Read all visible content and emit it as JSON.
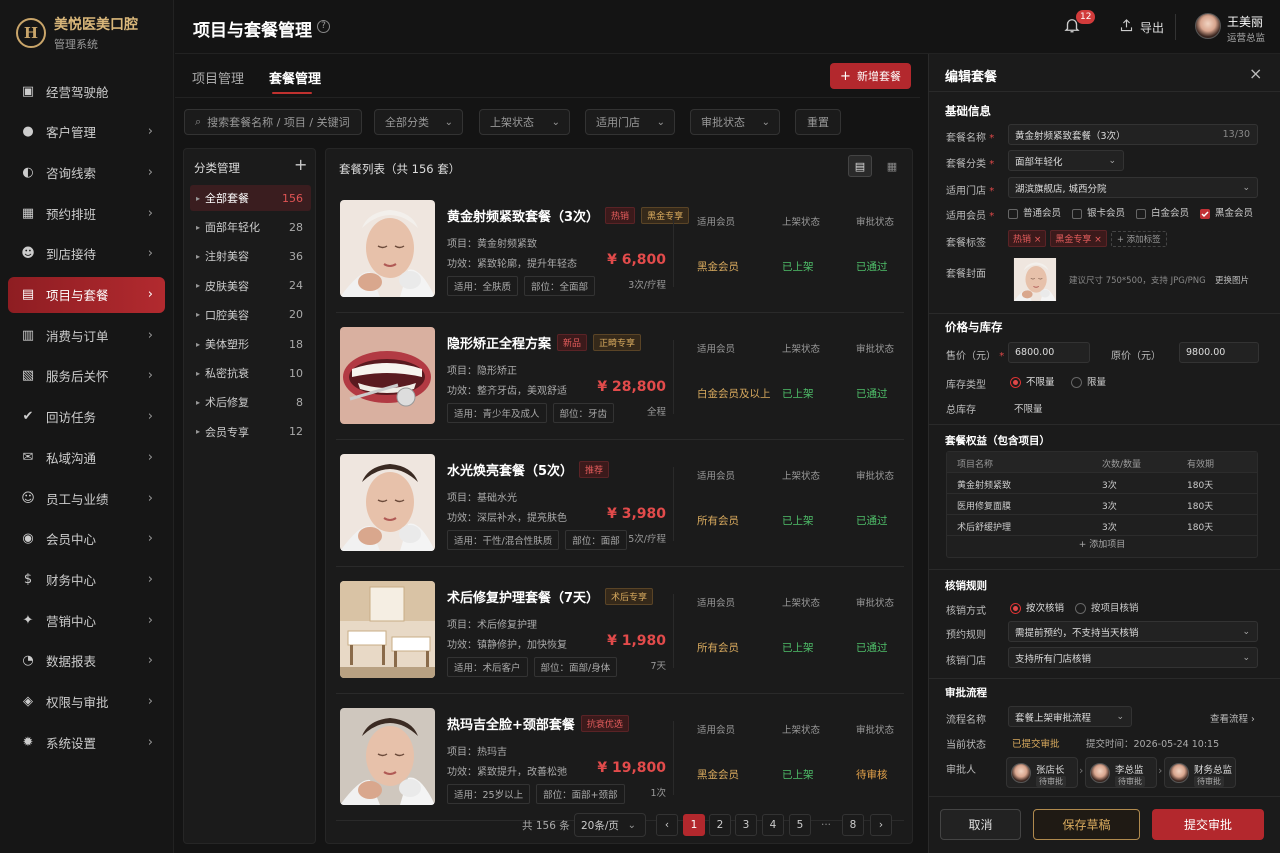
{
  "brand": {
    "logo": "H",
    "name": "美悦医美口腔",
    "sub": "管理系统"
  },
  "nav": [
    {
      "label": "经营驾驶舱",
      "icon": "dashboard-icon",
      "glyph": "▣",
      "chev": false
    },
    {
      "label": "客户管理",
      "icon": "user-icon",
      "glyph": "●",
      "chev": true
    },
    {
      "label": "咨询线索",
      "icon": "consult-icon",
      "glyph": "◐",
      "chev": true
    },
    {
      "label": "预约排班",
      "icon": "calendar-icon",
      "glyph": "▦",
      "chev": true
    },
    {
      "label": "到店接待",
      "icon": "reception-icon",
      "glyph": "☻",
      "chev": true
    },
    {
      "label": "项目与套餐",
      "icon": "package-icon",
      "glyph": "▤",
      "chev": true
    },
    {
      "label": "消费与订单",
      "icon": "order-icon",
      "glyph": "▥",
      "chev": true
    },
    {
      "label": "服务后关怀",
      "icon": "care-icon",
      "glyph": "▧",
      "chev": true
    },
    {
      "label": "回访任务",
      "icon": "task-icon",
      "glyph": "✔",
      "chev": true
    },
    {
      "label": "私域沟通",
      "icon": "chat-icon",
      "glyph": "✉",
      "chev": true
    },
    {
      "label": "员工与业绩",
      "icon": "staff-icon",
      "glyph": "☺",
      "chev": true
    },
    {
      "label": "会员中心",
      "icon": "member-icon",
      "glyph": "◉",
      "chev": true
    },
    {
      "label": "财务中心",
      "icon": "finance-icon",
      "glyph": "$",
      "chev": true
    },
    {
      "label": "营销中心",
      "icon": "marketing-icon",
      "glyph": "✦",
      "chev": true
    },
    {
      "label": "数据报表",
      "icon": "report-icon",
      "glyph": "◔",
      "chev": true
    },
    {
      "label": "权限与审批",
      "icon": "shield-icon",
      "glyph": "◈",
      "chev": true
    },
    {
      "label": "系统设置",
      "icon": "gear-icon",
      "glyph": "✹",
      "chev": true
    }
  ],
  "header": {
    "title": "项目与套餐管理",
    "notif_count": "12",
    "export": "导出",
    "user_name": "王美丽",
    "user_role": "运营总监"
  },
  "tabs": [
    "项目管理",
    "套餐管理"
  ],
  "new_button": "新增套餐",
  "filters": {
    "search_placeholder": "搜索套餐名称 / 项目 / 关键词",
    "category": "全部分类",
    "shelf": "上架状态",
    "store": "适用门店",
    "approval": "审批状态",
    "reset": "重置"
  },
  "categories": {
    "title": "分类管理",
    "items": [
      {
        "name": "全部套餐",
        "count": "156"
      },
      {
        "name": "面部年轻化",
        "count": "28"
      },
      {
        "name": "注射美容",
        "count": "36"
      },
      {
        "name": "皮肤美容",
        "count": "24"
      },
      {
        "name": "口腔美容",
        "count": "20"
      },
      {
        "name": "美体塑形",
        "count": "18"
      },
      {
        "name": "私密抗衰",
        "count": "10"
      },
      {
        "name": "术后修复",
        "count": "8"
      },
      {
        "name": "会员专享",
        "count": "12"
      }
    ]
  },
  "list": {
    "title": "套餐列表（共 156 套）",
    "col_member": "适用会员",
    "col_shelf": "上架状态",
    "col_approval": "审批状态",
    "items": [
      {
        "title": "黄金射频紧致套餐（3次）",
        "tags": [
          {
            "t": "热销",
            "c": "red"
          },
          {
            "t": "黑金专享",
            "c": "gold"
          }
        ],
        "project": "项目：黄金射频紧致",
        "effect": "功效：紧致轮廓，提升年轻态",
        "chips": [
          "适用：全肤质",
          "部位：全面部"
        ],
        "price": "¥ 6,800",
        "unit": "3次/疗程",
        "member": "黑金会员",
        "shelf": "已上架",
        "approval": "已通过",
        "approval_color": "green",
        "thumb": "face"
      },
      {
        "title": "隐形矫正全程方案",
        "tags": [
          {
            "t": "新品",
            "c": "red"
          },
          {
            "t": "正畸专享",
            "c": "gold"
          }
        ],
        "project": "项目：隐形矫正",
        "effect": "功效：整齐牙齿，美观舒适",
        "chips": [
          "适用：青少年及成人",
          "部位：牙齿"
        ],
        "price": "¥ 28,800",
        "unit": "全程",
        "member": "白金会员及以上",
        "shelf": "已上架",
        "approval": "已通过",
        "approval_color": "green",
        "thumb": "teeth"
      },
      {
        "title": "水光焕亮套餐（5次）",
        "tags": [
          {
            "t": "推荐",
            "c": "red"
          }
        ],
        "project": "项目：基础水光",
        "effect": "功效：深层补水，提亮肤色",
        "chips": [
          "适用：干性/混合性肤质",
          "部位：面部"
        ],
        "price": "¥ 3,980",
        "unit": "5次/疗程",
        "member": "所有会员",
        "shelf": "已上架",
        "approval": "已通过",
        "approval_color": "green",
        "thumb": "face2"
      },
      {
        "title": "术后修复护理套餐（7天）",
        "tags": [
          {
            "t": "术后专享",
            "c": "gold"
          }
        ],
        "project": "项目：术后修复护理",
        "effect": "功效：镇静修护，加快恢复",
        "chips": [
          "适用：术后客户",
          "部位：面部/身体"
        ],
        "price": "¥ 1,980",
        "unit": "7天",
        "member": "所有会员",
        "shelf": "已上架",
        "approval": "已通过",
        "approval_color": "green",
        "thumb": "room"
      },
      {
        "title": "热玛吉全脸+颈部套餐",
        "tags": [
          {
            "t": "抗衰优选",
            "c": "red"
          }
        ],
        "project": "项目：热玛吉",
        "effect": "功效：紧致提升，改善松弛",
        "chips": [
          "适用：25岁以上",
          "部位：面部+颈部"
        ],
        "price": "¥ 19,800",
        "unit": "1次",
        "member": "黑金会员",
        "shelf": "已上架",
        "approval": "待审核",
        "approval_color": "orange",
        "thumb": "face3"
      }
    ]
  },
  "pagination": {
    "total": "共 156 条",
    "size": "20条/页",
    "pages": [
      "1",
      "2",
      "3",
      "4",
      "5",
      "···",
      "8"
    ],
    "prev": "‹",
    "next": "›"
  },
  "edit": {
    "title": "编辑套餐",
    "basic": "基础信息",
    "name_label": "套餐名称",
    "name_value": "黄金射频紧致套餐（3次）",
    "name_count": "13/30",
    "cat_label": "套餐分类",
    "cat_value": "面部年轻化",
    "store_label": "适用门店",
    "store_value": "湖滨旗舰店, 城西分院",
    "member_label": "适用会员",
    "members": [
      {
        "n": "普通会员",
        "on": false
      },
      {
        "n": "银卡会员",
        "on": false
      },
      {
        "n": "白金会员",
        "on": false
      },
      {
        "n": "黑金会员",
        "on": true
      }
    ],
    "tag_label": "套餐标签",
    "tags": [
      "热销",
      "黑金专享"
    ],
    "add_tag": "+ 添加标签",
    "cover_label": "套餐封面",
    "cover_hint": "建议尺寸 750*500，支持 JPG/PNG",
    "cover_change": "更换图片",
    "price_sec": "价格与库存",
    "sale_label": "售价（元）",
    "sale_value": "6800.00",
    "orig_label": "原价（元）",
    "orig_value": "9800.00",
    "stock_type_label": "库存类型",
    "stock_opts": [
      "不限量",
      "限量"
    ],
    "stock_label": "总库存",
    "stock_value": "不限量",
    "benefit_sec": "套餐权益（包含项目）",
    "bt_head": [
      "项目名称",
      "次数/数量",
      "有效期"
    ],
    "bt_rows": [
      [
        "黄金射频紧致",
        "3次",
        "180天"
      ],
      [
        "医用修复面膜",
        "3次",
        "180天"
      ],
      [
        "术后舒缓护理",
        "3次",
        "180天"
      ]
    ],
    "add_item": "+ 添加项目",
    "verify_sec": "核销规则",
    "verify_way_label": "核销方式",
    "verify_opts": [
      "按次核销",
      "按项目核销"
    ],
    "appoint_label": "预约规则",
    "appoint_value": "需提前预约，不支持当天核销",
    "vstore_label": "核销门店",
    "vstore_value": "支持所有门店核销",
    "flow_sec": "审批流程",
    "flow_label": "流程名称",
    "flow_value": "套餐上架审批流程",
    "flow_view": "查看流程 ›",
    "status_label": "当前状态",
    "status_value": "已提交审批",
    "submit_time": "提交时间：2026-05-24 10:15",
    "approver_label": "审批人",
    "approvers": [
      {
        "n": "张店长",
        "s": "待审批"
      },
      {
        "n": "李总监",
        "s": "待审批"
      },
      {
        "n": "财务总监",
        "s": "待审批"
      }
    ],
    "cancel": "取消",
    "draft": "保存草稿",
    "submit": "提交审批"
  }
}
